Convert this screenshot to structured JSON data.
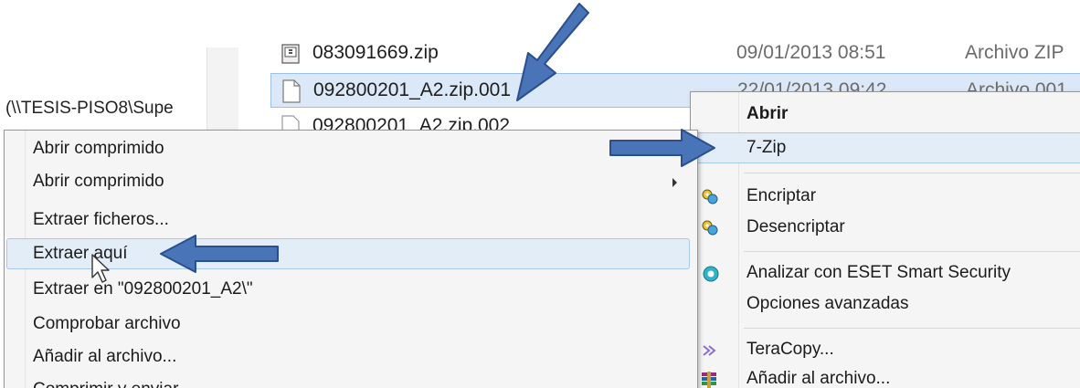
{
  "explorer": {
    "nav_path": "(\\\\TESIS-PISO8\\Supe",
    "files": [
      {
        "name": "083091669.zip",
        "date": "09/01/2013 08:51",
        "type": "Archivo ZIP"
      },
      {
        "name": "092800201_A2.zip.001",
        "date": "22/01/2013 09:42",
        "type": "Archivo 001"
      },
      {
        "name": "092800201_A2.zip.002",
        "date": "",
        "type": ""
      }
    ]
  },
  "main_menu": {
    "items": [
      {
        "label": "Abrir",
        "bold": true
      },
      {
        "label": "7-Zip",
        "highlighted": true
      },
      {
        "label": "Encriptar",
        "icon": "key-icon"
      },
      {
        "label": "Desencriptar",
        "icon": "key-icon"
      },
      {
        "label": "Analizar con ESET Smart Security",
        "icon": "eset-icon"
      },
      {
        "label": "Opciones avanzadas"
      },
      {
        "label": "TeraCopy...",
        "icon": "teracopy-icon"
      },
      {
        "label": "Añadir al archivo...",
        "icon": "winrar-icon"
      }
    ]
  },
  "zip_submenu": {
    "items": [
      {
        "label": "Abrir comprimido"
      },
      {
        "label": "Abrir comprimido",
        "has_submenu": true
      },
      {
        "label": "Extraer ficheros..."
      },
      {
        "label": "Extraer aquí",
        "highlighted": true
      },
      {
        "label": "Extraer en \"092800201_A2\\\""
      },
      {
        "label": "Comprobar archivo"
      },
      {
        "label": "Añadir al archivo..."
      },
      {
        "label": "Comprimir y enviar..."
      }
    ]
  },
  "colors": {
    "annotation_arrow": "#4a74b8",
    "annotation_arrow_edge": "#2a4f8e",
    "highlight_bg": "#e3edf8",
    "highlight_border": "#a8c8ea"
  }
}
